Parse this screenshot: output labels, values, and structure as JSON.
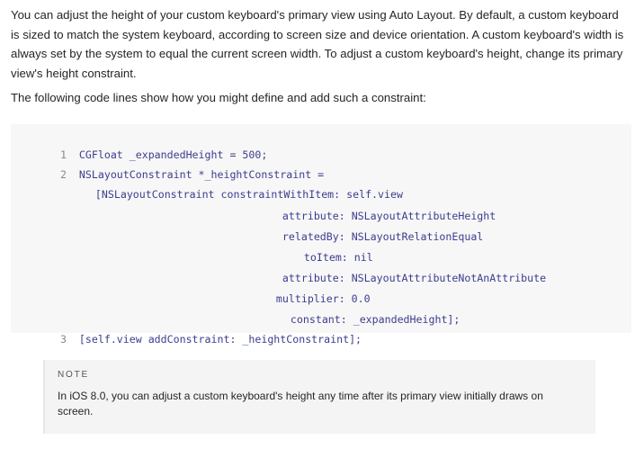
{
  "paragraphs": {
    "intro": "You can adjust the height of your custom keyboard's primary view using Auto Layout. By default, a custom keyboard is sized to match the system keyboard, according to screen size and device orientation. A custom keyboard's width is always set by the system to equal the current screen width. To adjust a custom keyboard's height, change its primary view's height constraint.",
    "code_intro": "The following code lines show how you might define and add such a constraint:"
  },
  "code": {
    "lines": [
      {
        "num": "1",
        "text": "CGFloat _expandedHeight = 500;"
      },
      {
        "num": "2",
        "text": "NSLayoutConstraint *_heightConstraint ="
      },
      {
        "num": "",
        "text": "[NSLayoutConstraint constraintWithItem: self.view"
      },
      {
        "num": "",
        "text": "attribute: NSLayoutAttributeHeight"
      },
      {
        "num": "",
        "text": "relatedBy: NSLayoutRelationEqual"
      },
      {
        "num": "",
        "text": "toItem: nil"
      },
      {
        "num": "",
        "text": "attribute: NSLayoutAttributeNotAnAttribute"
      },
      {
        "num": "",
        "text": "multiplier: 0.0"
      },
      {
        "num": "",
        "text": "constant: _expandedHeight];"
      },
      {
        "num": "3",
        "text": "[self.view addConstraint: _heightConstraint];"
      }
    ]
  },
  "note": {
    "label": "NOTE",
    "text": "In iOS 8.0, you can adjust a custom keyboard's height any time after its primary view initially draws on screen."
  }
}
